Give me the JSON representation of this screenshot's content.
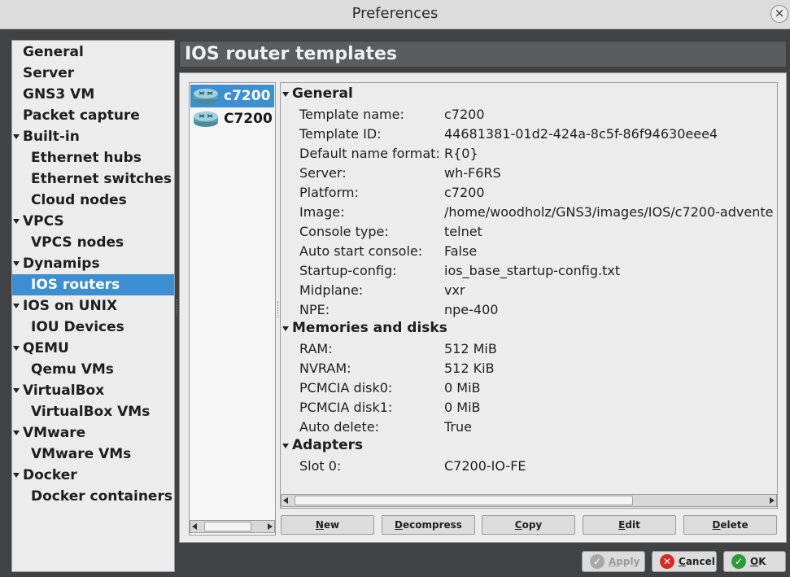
{
  "window": {
    "title": "Preferences",
    "close_glyph": "×"
  },
  "sidebar": {
    "items": [
      {
        "label": "General"
      },
      {
        "label": "Server"
      },
      {
        "label": "GNS3 VM"
      },
      {
        "label": "Packet capture"
      },
      {
        "label": "Built-in"
      },
      {
        "label": "Ethernet hubs"
      },
      {
        "label": "Ethernet switches"
      },
      {
        "label": "Cloud nodes"
      },
      {
        "label": "VPCS"
      },
      {
        "label": "VPCS nodes"
      },
      {
        "label": "Dynamips"
      },
      {
        "label": "IOS routers"
      },
      {
        "label": "IOS on UNIX"
      },
      {
        "label": "IOU Devices"
      },
      {
        "label": "QEMU"
      },
      {
        "label": "Qemu VMs"
      },
      {
        "label": "VirtualBox"
      },
      {
        "label": "VirtualBox VMs"
      },
      {
        "label": "VMware"
      },
      {
        "label": "VMware VMs"
      },
      {
        "label": "Docker"
      },
      {
        "label": "Docker containers"
      }
    ],
    "selected": "IOS routers"
  },
  "page_title": "IOS router templates",
  "templates": [
    {
      "label": "c7200",
      "icon": "router-icon"
    },
    {
      "label": "C7200",
      "icon": "router-icon"
    }
  ],
  "details": {
    "general": {
      "header": "General",
      "rows": [
        {
          "key": "Template name:",
          "value": "c7200"
        },
        {
          "key": "Template ID:",
          "value": "44681381-01d2-424a-8c5f-86f94630eee4"
        },
        {
          "key": "Default name format:",
          "value": "R{0}"
        },
        {
          "key": "Server:",
          "value": "wh-F6RS"
        },
        {
          "key": "Platform:",
          "value": "c7200"
        },
        {
          "key": "Image:",
          "value": "/home/woodholz/GNS3/images/IOS/c7200-advente"
        },
        {
          "key": "Console type:",
          "value": "telnet"
        },
        {
          "key": "Auto start console:",
          "value": "False"
        },
        {
          "key": "Startup-config:",
          "value": "ios_base_startup-config.txt"
        },
        {
          "key": "Midplane:",
          "value": "vxr"
        },
        {
          "key": "NPE:",
          "value": "npe-400"
        }
      ]
    },
    "memories": {
      "header": "Memories and disks",
      "rows": [
        {
          "key": "RAM:",
          "value": "512 MiB"
        },
        {
          "key": "NVRAM:",
          "value": "512 KiB"
        },
        {
          "key": "PCMCIA disk0:",
          "value": "0 MiB"
        },
        {
          "key": "PCMCIA disk1:",
          "value": "0 MiB"
        },
        {
          "key": "Auto delete:",
          "value": "True"
        }
      ]
    },
    "adapters": {
      "header": "Adapters",
      "rows": [
        {
          "key": "Slot 0:",
          "value": "C7200-IO-FE"
        }
      ]
    }
  },
  "actions": {
    "new": {
      "u": "N",
      "rest": "ew"
    },
    "decompress": {
      "u": "D",
      "rest": "ecompress"
    },
    "copy": {
      "u": "C",
      "rest": "opy"
    },
    "edit": {
      "u": "E",
      "rest": "dit"
    },
    "delete": {
      "u": "D",
      "rest": "elete"
    }
  },
  "dialog": {
    "apply": {
      "u": "A",
      "rest": "pply"
    },
    "cancel": {
      "u": "C",
      "rest": "ancel"
    },
    "ok": {
      "u": "O",
      "rest": "K"
    }
  },
  "colors": {
    "selection": "#3d8fd1",
    "title_bar": "#5a5c5e",
    "cancel_icon": "#d62a2a",
    "ok_icon": "#2e9a3a",
    "apply_icon": "#a8a8a8"
  }
}
